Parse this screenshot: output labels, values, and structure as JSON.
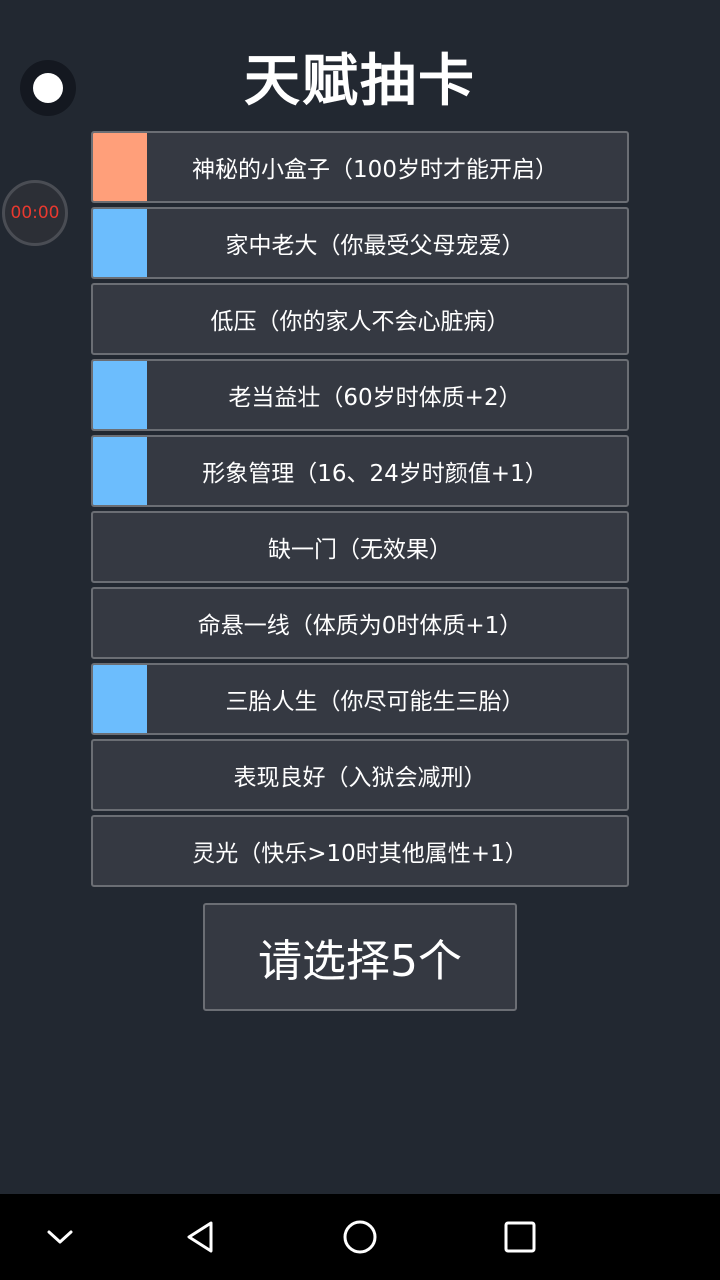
{
  "title": "天赋抽卡",
  "timer": "00:00",
  "colors": {
    "background": "#222831",
    "card": "#353942",
    "card_border": "#6b6e74",
    "orange": "#ff9f7a",
    "blue": "#6cbdfd",
    "timer_text": "#e8392f"
  },
  "cards": [
    {
      "label": "神秘的小盒子（100岁时才能开启）",
      "marker": "orange"
    },
    {
      "label": "家中老大（你最受父母宠爱）",
      "marker": "blue"
    },
    {
      "label": "低压（你的家人不会心脏病）",
      "marker": "none"
    },
    {
      "label": "老当益壮（60岁时体质+2）",
      "marker": "blue"
    },
    {
      "label": "形象管理（16、24岁时颜值+1）",
      "marker": "blue"
    },
    {
      "label": "缺一门（无效果）",
      "marker": "none"
    },
    {
      "label": "命悬一线（体质为0时体质+1）",
      "marker": "none"
    },
    {
      "label": "三胎人生（你尽可能生三胎）",
      "marker": "blue"
    },
    {
      "label": "表现良好（入狱会减刑）",
      "marker": "none"
    },
    {
      "label": "灵光（快乐>10时其他属性+1）",
      "marker": "none"
    }
  ],
  "confirm_label": "请选择5个",
  "navbar": {
    "items": [
      "chevron-down-icon",
      "back-triangle-icon",
      "home-circle-icon",
      "recents-square-icon"
    ]
  }
}
